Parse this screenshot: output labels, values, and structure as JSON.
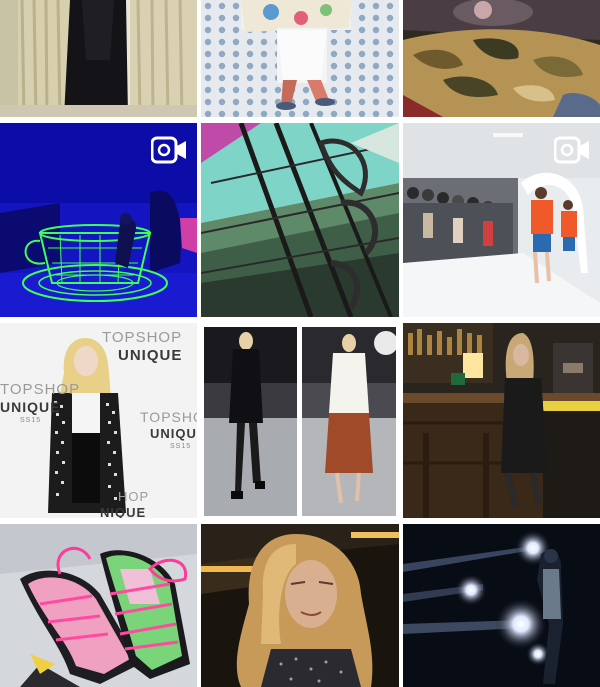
{
  "grid": {
    "tiles": [
      {
        "id": "t1",
        "scene": "curtain-coat",
        "video": false
      },
      {
        "id": "t2",
        "scene": "runway-dotted-floor",
        "video": false
      },
      {
        "id": "t3",
        "scene": "camo-bag-cat",
        "video": false
      },
      {
        "id": "t4",
        "scene": "neon-teacup",
        "video": true
      },
      {
        "id": "t5",
        "scene": "skylight-sculpture",
        "video": false
      },
      {
        "id": "t6",
        "scene": "catwalk-show",
        "video": true
      },
      {
        "id": "t7",
        "scene": "topshop-unique-portrait",
        "video": false
      },
      {
        "id": "t8",
        "scene": "runway-diptych",
        "video": false
      },
      {
        "id": "t9",
        "scene": "bar-portrait",
        "video": false
      },
      {
        "id": "t10",
        "scene": "pink-lace-shoes",
        "video": false
      },
      {
        "id": "t11",
        "scene": "selfie",
        "video": false
      },
      {
        "id": "t12",
        "scene": "spotlight-silhouette",
        "video": false
      }
    ]
  },
  "brand": {
    "top1": "TOPSHOP",
    "unique1": "UNIQUE",
    "top2": "TOPSHOP",
    "unique2": "UNIQUE",
    "season": "SS15",
    "top3": "TOPSHOP",
    "unique3": "UNIQUE",
    "season2": "SS15",
    "top4": "HOP",
    "unique4": "NIQUE"
  },
  "colors": {
    "neon_blue": "#1a1acc",
    "neon_green": "#3cff5a",
    "camo_tan": "#b08a4a",
    "runway_orange": "#f05a2a"
  }
}
